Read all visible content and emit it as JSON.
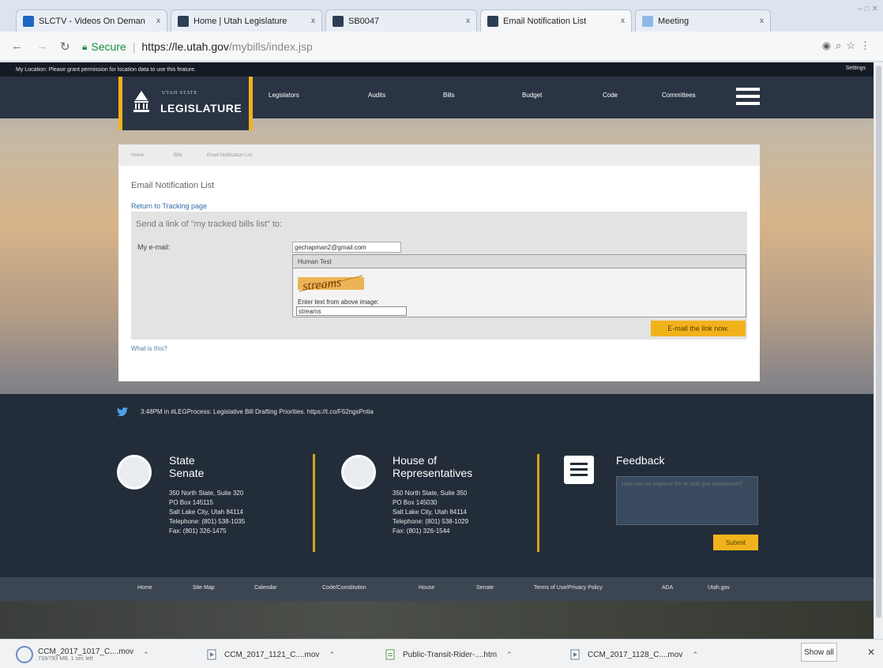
{
  "browser": {
    "tabs": [
      {
        "label": "SLCTV - Videos On Deman",
        "close": "x",
        "active": false
      },
      {
        "label": "Home | Utah Legislature",
        "close": "x",
        "active": false
      },
      {
        "label": "SB0047",
        "close": "x",
        "active": false
      },
      {
        "label": "Email Notification List",
        "close": "x",
        "active": true
      },
      {
        "label": "Meeting",
        "close": "x",
        "active": false
      }
    ],
    "address": {
      "secure_label": "Secure",
      "url_host": "https://le.utah.gov",
      "url_path": "/mybills/index.jsp"
    }
  },
  "site": {
    "location_notice": "My Location: Please grant permission for location data to use this feature.",
    "settings_label": "Settings",
    "logo": {
      "small": "UTAH STATE",
      "big": "LEGISLATURE"
    },
    "nav": [
      "Legislators",
      "Audits",
      "Bills",
      "Budget",
      "Code",
      "Committees"
    ]
  },
  "panel": {
    "breadcrumbs": [
      "Home",
      "Bills",
      "Email Notification List"
    ],
    "title": "Email Notification List",
    "return_link": "Return to Tracking page",
    "send_label": "Send a link of \"my tracked bills list\" to:",
    "email_label": "My e-mail:",
    "email_value": "gechapman2@gmail.com",
    "captcha_header": "Human Test",
    "captcha_word": "streams",
    "captcha_prompt": "Enter text from above image:",
    "captcha_value": "streams",
    "email_button": "E-mail the link now.",
    "what_is_this": "What is this?"
  },
  "footer": {
    "tweet": "3:48PM in #LEGProcess: Legislative Bill Drafting Priorities. https://t.co/F62ngsPntia",
    "senate": {
      "title_line1": "State",
      "title_line2": "Senate",
      "address": [
        "350 North State, Suite 320",
        "PO Box 145115",
        "Salt Lake City, Utah 84114",
        "Telephone: (801) 538-1035",
        "Fax: (801) 326-1475"
      ]
    },
    "house": {
      "title_line1": "House of",
      "title_line2": "Representatives",
      "address": [
        "350 North State, Suite 350",
        "PO Box 145030",
        "Salt Lake City, Utah 84114",
        "Telephone: (801) 538-1029",
        "Fax: (801) 326-1544"
      ]
    },
    "feedback": {
      "title": "Feedback",
      "placeholder": "How can we improve the le.utah.gov experience?",
      "submit": "Submit"
    },
    "links": [
      "Home",
      "Site Map",
      "Calendar",
      "Code/Constitution",
      "House",
      "Senate",
      "Terms of Use/Privacy Policy",
      "ADA",
      "Utah.gov"
    ]
  },
  "downloads": {
    "items": [
      {
        "name": "CCM_2017_1017_C....mov",
        "sub": "733/793 MB, 1 sec left"
      },
      {
        "name": "CCM_2017_1121_C....mov",
        "sub": ""
      },
      {
        "name": "Public-Transit-Rider-....htm",
        "sub": ""
      },
      {
        "name": "CCM_2017_1128_C....mov",
        "sub": ""
      }
    ],
    "show_all": "Show all",
    "close": "✕"
  },
  "colors": {
    "accent": "#f1b21c",
    "nav_bg": "#2a3444",
    "footer_bg": "#232d3a",
    "link": "#2f6ba8"
  }
}
